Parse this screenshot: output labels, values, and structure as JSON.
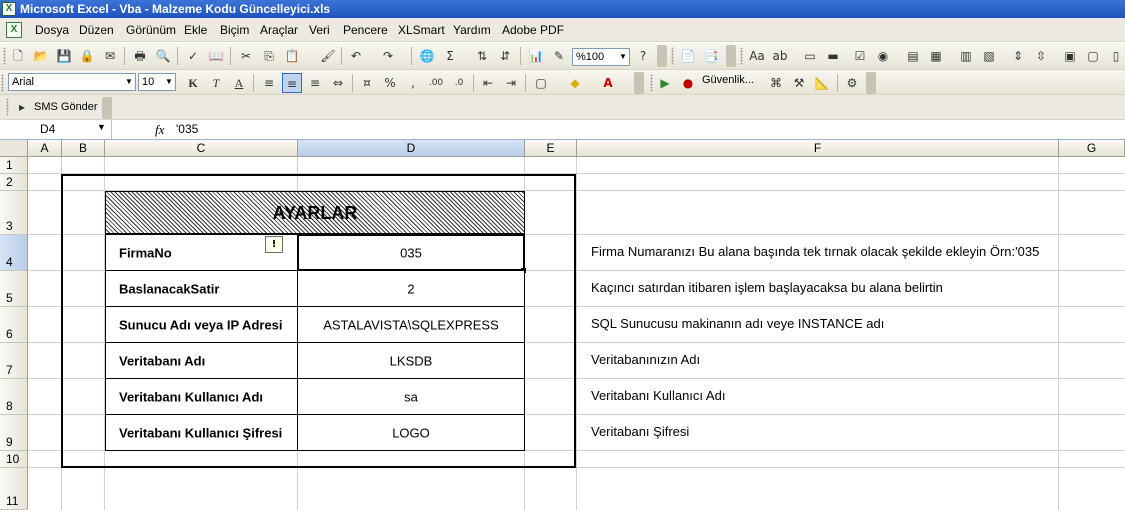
{
  "window": {
    "title": "Microsoft Excel - Vba - Malzeme Kodu Güncelleyici.xls"
  },
  "menu": [
    "Dosya",
    "Düzen",
    "Görünüm",
    "Ekle",
    "Biçim",
    "Araçlar",
    "Veri",
    "Pencere",
    "XLSmart",
    "Yardım",
    "Adobe PDF"
  ],
  "toolbar": {
    "zoom": "%100",
    "font_name": "Arial",
    "font_size": "10",
    "security_label": "Güvenlik...",
    "sms_label": "SMS Gönder"
  },
  "formula_bar": {
    "name_box": "D4",
    "fx": "fx",
    "value": "'035"
  },
  "columns": [
    "A",
    "B",
    "C",
    "D",
    "E",
    "F",
    "G"
  ],
  "rows": [
    "1",
    "2",
    "3",
    "4",
    "5",
    "6",
    "7",
    "8",
    "9",
    "10",
    "11"
  ],
  "sheet": {
    "header": "AYARLAR",
    "settings": [
      {
        "label": "FirmaNo",
        "value": "035",
        "note": "Firma Numaranızı Bu alana başında tek tırnak olacak şekilde ekleyin Örn:'035"
      },
      {
        "label": "BaslanacakSatir",
        "value": "2",
        "note": "Kaçıncı satırdan itibaren işlem başlayacaksa bu alana belirtin"
      },
      {
        "label": "Sunucu Adı veya IP Adresi",
        "value": "ASTALAVISTA\\SQLEXPRESS",
        "note": "SQL Sunucusu makinanın adı veye INSTANCE adı"
      },
      {
        "label": "Veritabanı Adı",
        "value": "LKSDB",
        "note": "Veritabanınızın Adı"
      },
      {
        "label": "Veritabanı Kullanıcı Adı",
        "value": "sa",
        "note": "Veritabanı Kullanıcı Adı"
      },
      {
        "label": "Veritabanı Kullanıcı Şifresi",
        "value": "LOGO",
        "note": "Veritabanı Şifresi"
      }
    ]
  },
  "colors": {
    "title_bar": "#1d53bb",
    "toolbar_bg": "#eceae0",
    "header_active": "#b8cde8",
    "grid_line": "#d4d0c8"
  }
}
